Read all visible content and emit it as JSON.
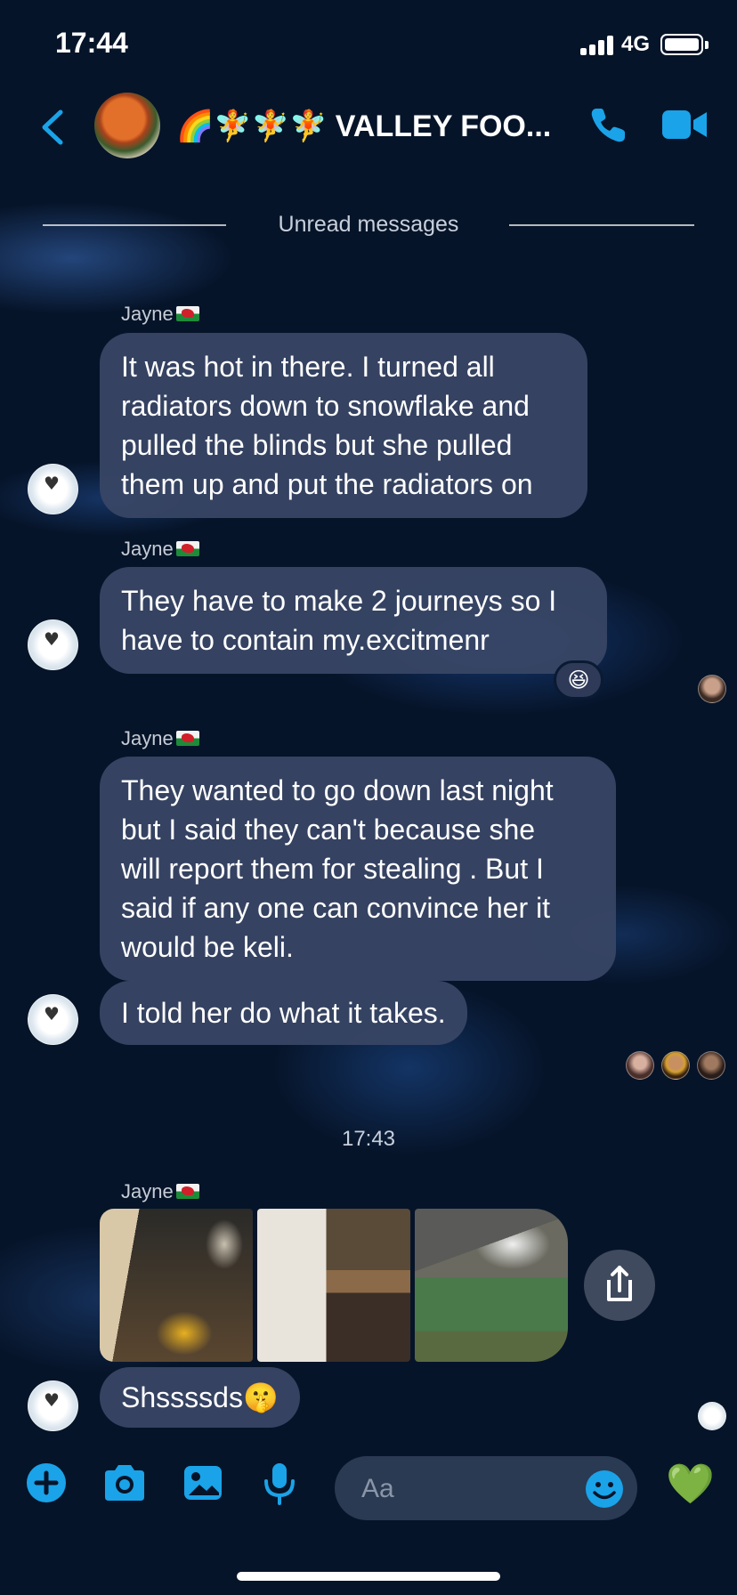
{
  "status_bar": {
    "time": "17:44",
    "network": "4G"
  },
  "header": {
    "title": "🌈🧚🧚🧚 VALLEY FOO..."
  },
  "divider": {
    "unread_label": "Unread messages"
  },
  "messages": [
    {
      "sender": "Jayne",
      "text_lines": [
        "It was hot in there. I turned all",
        "radiators down to snowflake and",
        "pulled the blinds but she pulled",
        "them up and put the radiators on"
      ]
    },
    {
      "sender": "Jayne",
      "text_lines": [
        "They have to make 2 journeys so I",
        "have to contain my.excitmenr"
      ],
      "reaction": "😆"
    },
    {
      "sender": "Jayne",
      "text_lines": [
        "They wanted to go down last night",
        "but I said they can't because she",
        "will report them for stealing .  But I",
        "said  if any one can convince her it",
        "would be keli."
      ]
    },
    {
      "text": "I told her do what it takes."
    },
    {
      "sender": "Jayne",
      "photos": 3
    },
    {
      "text": "Shssssds🤫"
    }
  ],
  "timestamp": "17:43",
  "composer": {
    "placeholder": "Aa",
    "like_emoji": "💚"
  },
  "colors": {
    "accent": "#1aa3e8",
    "bubble": "#3a4666",
    "background": "#061429"
  }
}
